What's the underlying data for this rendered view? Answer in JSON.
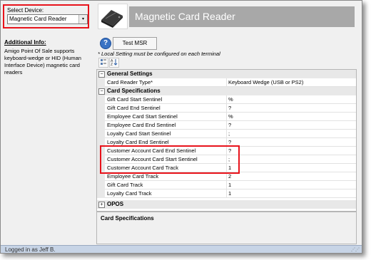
{
  "device_selector": {
    "label": "Select Device:",
    "selected": "Magnetic Card Reader",
    "arrow": "▾"
  },
  "info": {
    "heading": "Additional Info:",
    "text": "Amigo Point Of Sale supports keyboard-wedge or HID (Human Interface Device) magnetic card readers"
  },
  "header": {
    "title": "Magnetic Card Reader"
  },
  "actions": {
    "help_glyph": "?",
    "test_label": "Test MSR",
    "note": "* Local Setting must be configured on each terminal"
  },
  "property_grid": {
    "sections": {
      "general": {
        "label": "General Settings",
        "toggle": "−"
      },
      "card_specs": {
        "label": "Card Specifications",
        "toggle": "−"
      },
      "opos": {
        "label": "OPOS",
        "toggle": "+"
      }
    },
    "rows": [
      {
        "name": "Card Reader Type*",
        "value": "Keyboard Wedge (USB or PS2)"
      },
      {
        "name": "Gift Card Start Sentinel",
        "value": "%"
      },
      {
        "name": "Gift Card End Sentinel",
        "value": "?"
      },
      {
        "name": "Employee Card Start Sentinel",
        "value": "%"
      },
      {
        "name": "Employee Card End Sentinel",
        "value": "?"
      },
      {
        "name": "Loyalty Card Start Sentinel",
        "value": ";"
      },
      {
        "name": "Loyalty Card End Sentinel",
        "value": "?"
      },
      {
        "name": "Customer Account Card End Sentinel",
        "value": "?"
      },
      {
        "name": "Customer Account Card Start Sentinel",
        "value": ";"
      },
      {
        "name": "Customer Account Card Track",
        "value": "1"
      },
      {
        "name": "Employee Card Track",
        "value": "2"
      },
      {
        "name": "Gift Card Track",
        "value": "1"
      },
      {
        "name": "Loyalty Card Track",
        "value": "1"
      }
    ]
  },
  "description": {
    "title": "Card Specifications"
  },
  "status": {
    "text": "Logged in as Jeff B."
  },
  "highlight_color": "#e8131b",
  "icons": {
    "categorized": "categorized-view-icon",
    "alphabetical": "alphabetical-sort-icon",
    "help": "help-icon"
  }
}
